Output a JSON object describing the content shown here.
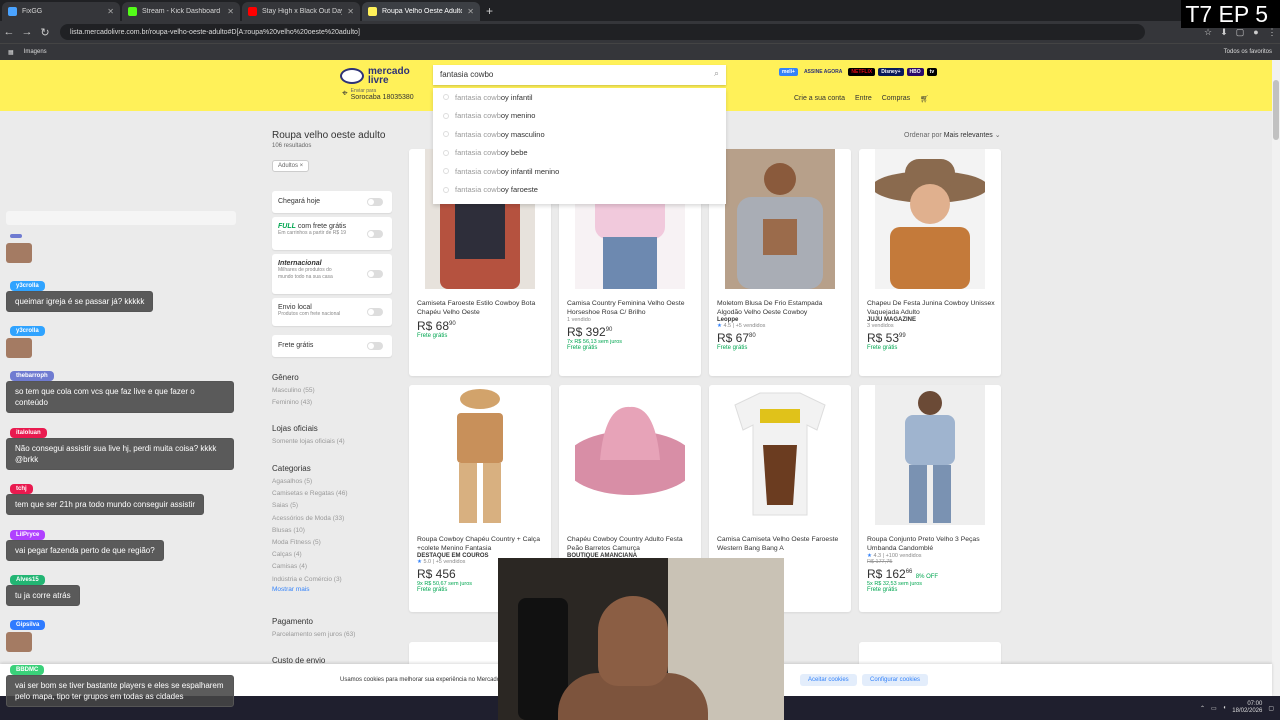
{
  "browser": {
    "tabs": [
      {
        "label": "FixGG",
        "color": "#4aa3ff",
        "active": false
      },
      {
        "label": "Stream - Kick Dashboard",
        "color": "#53fc18",
        "active": false
      },
      {
        "label": "Stay High x Black Out Days",
        "color": "#ff0000",
        "active": false
      },
      {
        "label": "Roupa Velho Oeste Adulto | Me",
        "color": "#fff159",
        "active": true
      }
    ],
    "url": "lista.mercadolivre.com.br/roupa-velho-oeste-adulto#D[A:roupa%20velho%20oeste%20adulto]",
    "bookmark_images": "Imagens",
    "bookmark_all": "Todos os favoritos"
  },
  "overlay": {
    "episode": "T7 EP 5"
  },
  "header": {
    "logo_line1": "mercado",
    "logo_line2": "livre",
    "search_value": "fantasia cowbo",
    "ship_label": "Enviar para",
    "ship_city": "Sorocaba 18035380",
    "streaming": [
      "meli+",
      "ASSINE AGORA",
      "NETFLIX",
      "Disney+",
      "HBO",
      "tv"
    ],
    "account_links": [
      "Crie a sua conta",
      "Entre",
      "Compras"
    ]
  },
  "suggestions": [
    {
      "prefix": "fantasia cowb",
      "suffix": "oy infantil"
    },
    {
      "prefix": "fantasia cowb",
      "suffix": "oy menino"
    },
    {
      "prefix": "fantasia cowb",
      "suffix": "oy masculino"
    },
    {
      "prefix": "fantasia cowb",
      "suffix": "oy bebe"
    },
    {
      "prefix": "fantasia cowb",
      "suffix": "oy infantil menino"
    },
    {
      "prefix": "fantasia cowb",
      "suffix": "oy faroeste"
    }
  ],
  "results": {
    "title": "Roupa velho oeste adulto",
    "count": "106 resultados",
    "chip": "Adultos ×",
    "sort_label": "Ordenar por",
    "sort_value": "Mais relevantes"
  },
  "filters": {
    "arrive_today": "Chegará hoje",
    "full_brand": "FULL",
    "full_text": "com frete grátis",
    "full_sub": "Em carrinhos a partir de R$ 19",
    "intl_title": "Internacional",
    "intl_sub": "Milhares de produtos do mundo todo na sua casa",
    "local_title": "Envio local",
    "local_sub": "Produtos com frete nacional",
    "free_ship": "Frete grátis",
    "genero_h": "Gênero",
    "genero": [
      "Masculino (55)",
      "Feminino (43)"
    ],
    "lojas_h": "Lojas oficiais",
    "lojas": [
      "Somente lojas oficiais (4)"
    ],
    "cat_h": "Categorias",
    "cats": [
      "Agasalhos (5)",
      "Camisetas e Regatas (46)",
      "Saias (5)",
      "Acessórios de Moda (33)",
      "Blusas (10)",
      "Moda Fitness (5)",
      "Calças (4)",
      "Camisas (4)",
      "Indústria e Comércio (3)"
    ],
    "more": "Mostrar mais",
    "pag_h": "Pagamento",
    "pag": [
      "Parcelamento sem juros (63)"
    ],
    "custo_h": "Custo de envio"
  },
  "products": [
    {
      "title": "Camiseta Faroeste Estilo Cowboy Bota Chapéu Velho Oeste",
      "store": "",
      "sub": "",
      "rating": "",
      "old": "",
      "price": "R$ 68",
      "cents": "90",
      "off": "",
      "inst": "",
      "ship": "Frete grátis",
      "img": "shirt",
      "c1": "#b5523f",
      "c2": "#2e2e3a"
    },
    {
      "title": "Camisa Country Feminina Velho Oeste Horseshoe Rosa C/ Brilho",
      "store": "",
      "sub": "1 vendido",
      "rating": "",
      "old": "",
      "price": "R$ 392",
      "cents": "90",
      "off": "",
      "inst": "7x R$ 56,13 sem juros",
      "ship": "Frete grátis",
      "img": "pink",
      "c1": "#f1c9dc",
      "c2": "#6d89b0"
    },
    {
      "title": "Moletom Blusa De Frio Estampada Algodão Velho Oeste Cowboy",
      "store": "Leoppe",
      "sub": "",
      "rating": "4.5 | +5 vendidos",
      "old": "",
      "price": "R$ 67",
      "cents": "80",
      "off": "",
      "inst": "",
      "ship": "Frete grátis",
      "img": "hoodie",
      "c1": "#a9adb5",
      "c2": "#9b6b4b"
    },
    {
      "title": "Chapeu De Festa Junina Cowboy Unissex Vaquejada Adulto",
      "store": "JUJU MAGAZINE",
      "sub": "3 vendidos",
      "rating": "",
      "old": "",
      "price": "R$ 53",
      "cents": "99",
      "off": "",
      "inst": "",
      "ship": "Frete grátis",
      "img": "hat",
      "c1": "#8a6a4e",
      "c2": "#c47a3a"
    },
    {
      "title": "Roupa Cowboy Chapéu Country + Calça +colete Menino Fantasia",
      "store": "DESTAQUE EM COUROS",
      "sub": "",
      "rating": "5.0 | +5 vendidos",
      "old": "",
      "price": "R$ 456",
      "cents": "",
      "off": "",
      "inst": "9x R$ 50,67 sem juros",
      "ship": "Frete grátis",
      "img": "vest",
      "c1": "#c8905a",
      "c2": "#d8b080"
    },
    {
      "title": "Chapéu Cowboy Country Adulto Festa Peão Barretos Camurça",
      "store": "BOUTIQUE AMANCIANA",
      "sub": "",
      "rating": "",
      "old": "",
      "price": "",
      "cents": "",
      "off": "",
      "inst": "",
      "ship": "",
      "img": "pinkhat",
      "c1": "#e7a3b8",
      "c2": "#d88ea6"
    },
    {
      "title": "Camisa Camiseta Velho Oeste Faroeste Western Bang Bang A",
      "store": "",
      "sub": "",
      "rating": "",
      "old": "",
      "price": "",
      "cents": "",
      "off": "",
      "inst": "",
      "ship": "",
      "img": "tee",
      "c1": "#f2f2f2",
      "c2": "#6b3c20"
    },
    {
      "title": "Roupa Conjunto Preto Velho 3 Peças Umbanda Candomblé",
      "store": "",
      "sub": "",
      "rating": "4.3 | +100 vendidos",
      "old": "R$ 177,75",
      "price": "R$ 162",
      "cents": "66",
      "off": "8% OFF",
      "inst": "5x R$ 32,53 sem juros",
      "ship": "Frete grátis",
      "img": "suit",
      "c1": "#9fb4cf",
      "c2": "#7a92b2"
    }
  ],
  "cookies": {
    "text": "Usamos cookies para melhorar sua experiência no Mercado Livre.",
    "accept": "Aceitar cookies",
    "configure": "Configurar cookies"
  },
  "chat": [
    {
      "name": "",
      "text": "",
      "color": "#6f7bd1",
      "avatar": true
    },
    {
      "name": "y3crolla",
      "text": "queimar igreja é se passar já? kkkkk",
      "color": "#2fa3ff",
      "avatar": false
    },
    {
      "name": "y3crolla",
      "text": "",
      "color": "#2fa3ff",
      "avatar": true
    },
    {
      "name": "thebarroph",
      "text": "so tem que cola com vcs que faz live e que fazer o conteúdo",
      "color": "#6f7bd1",
      "avatar": false
    },
    {
      "name": "italoluan",
      "text": "Não consegui assistir sua live hj, perdi muita coisa? kkkk @brkk",
      "color": "#e91a4f",
      "avatar": false
    },
    {
      "name": "tchj",
      "text": "tem que ser 21h pra todo mundo conseguir assistir",
      "color": "#e91a4f",
      "avatar": false
    },
    {
      "name": "LilPryce",
      "text": "vai pegar fazenda perto de que região?",
      "color": "#b040ff",
      "avatar": false
    },
    {
      "name": "Alves15",
      "text": "tu ja corre atrás",
      "color": "#22b573",
      "avatar": false
    },
    {
      "name": "Gipsilva",
      "text": "",
      "color": "#2f7bff",
      "avatar": true
    },
    {
      "name": "BBDMC",
      "text": "vai ser bom se tiver bastante players e eles se espalharem pelo mapa, tipo ter grupos em todas as cidades",
      "color": "#3ad17a",
      "avatar": false
    }
  ],
  "taskbar": {
    "time": "07:00",
    "date": "18/02/2026"
  }
}
